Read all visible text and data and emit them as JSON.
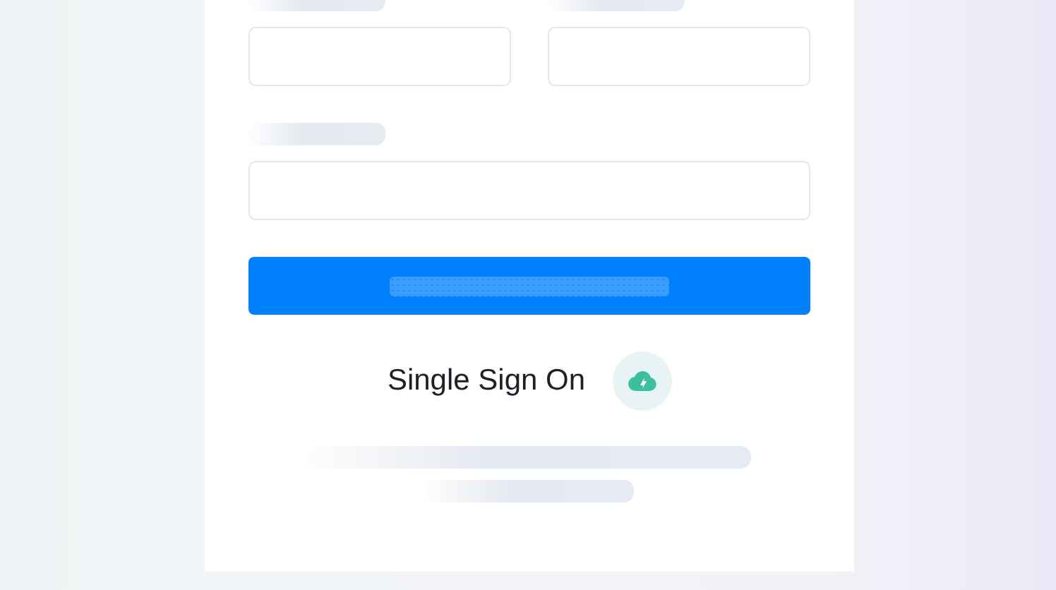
{
  "form": {
    "field_rows": [
      {
        "kind": "pair"
      },
      {
        "kind": "single"
      }
    ],
    "submit": {
      "kind": "skeleton"
    },
    "sso": {
      "label": "Single Sign On"
    },
    "footer": [
      {
        "kind": "long"
      },
      {
        "kind": "short"
      }
    ]
  }
}
